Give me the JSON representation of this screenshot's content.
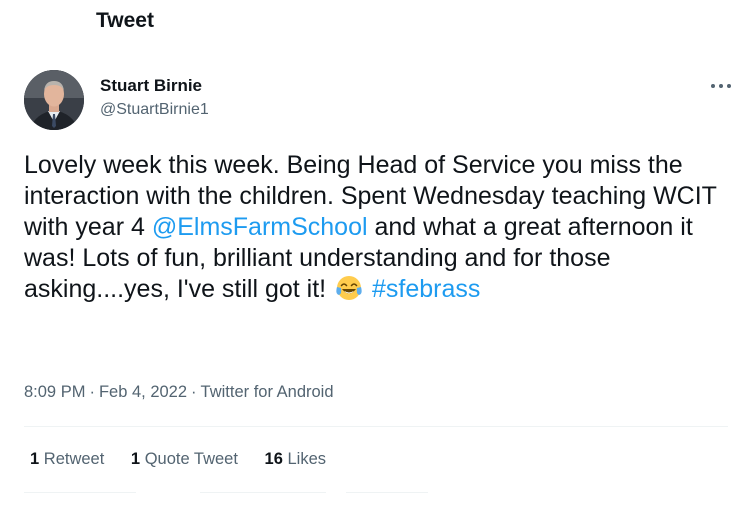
{
  "header": {
    "title": "Tweet"
  },
  "author": {
    "name": "Stuart Birnie",
    "handle": "@StuartBirnie1"
  },
  "tweet": {
    "text_part1": "Lovely week this week. Being Head of Service you miss the interaction with the children. Spent Wednesday teaching WCIT with year 4 ",
    "mention": "@ElmsFarmSchool",
    "text_part2": " and what a great afternoon it was! Lots of fun, brilliant understanding and for those asking....yes, I've still got it! ",
    "emoji": "face-with-tears-of-joy",
    "hashtag": "#sfebrass"
  },
  "meta": {
    "time": "8:09 PM",
    "date": "Feb 4, 2022",
    "source": "Twitter for Android",
    "separator": "·"
  },
  "stats": {
    "retweets_count": "1",
    "retweets_label": "Retweet",
    "quotes_count": "1",
    "quotes_label": "Quote Tweet",
    "likes_count": "16",
    "likes_label": "Likes"
  },
  "colors": {
    "link": "#1d9bf0",
    "secondary_text": "#536471",
    "primary_text": "#0f1419",
    "divider": "#eff3f4"
  },
  "icons": {
    "more": "more-horizontal-icon",
    "emoji": "face-with-tears-of-joy-icon"
  }
}
